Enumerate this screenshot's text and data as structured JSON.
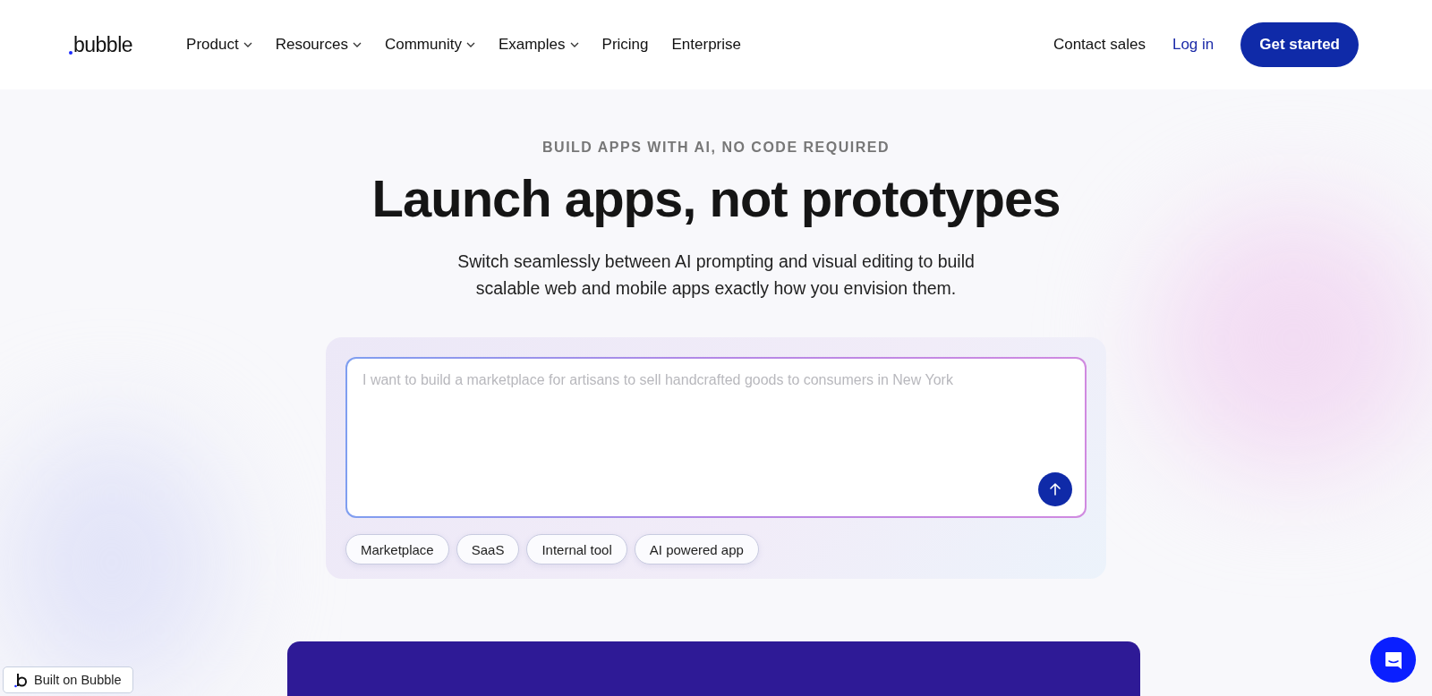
{
  "header": {
    "logo": "bubble",
    "nav": [
      {
        "label": "Product",
        "dropdown": true
      },
      {
        "label": "Resources",
        "dropdown": true
      },
      {
        "label": "Community",
        "dropdown": true
      },
      {
        "label": "Examples",
        "dropdown": true
      },
      {
        "label": "Pricing",
        "dropdown": false
      },
      {
        "label": "Enterprise",
        "dropdown": false
      }
    ],
    "contact": "Contact sales",
    "login": "Log in",
    "cta": "Get started"
  },
  "hero": {
    "eyebrow": "BUILD APPS WITH AI, NO CODE REQUIRED",
    "title": "Launch apps, not prototypes",
    "subtitle": "Switch seamlessly between AI prompting and visual editing to build scalable web and mobile apps exactly how you envision them."
  },
  "prompt": {
    "placeholder": "I want to build a marketplace for artisans to sell handcrafted goods to consumers in New York",
    "chips": [
      "Marketplace",
      "SaaS",
      "Internal tool",
      "AI powered app"
    ]
  },
  "badge": "Built on Bubble"
}
